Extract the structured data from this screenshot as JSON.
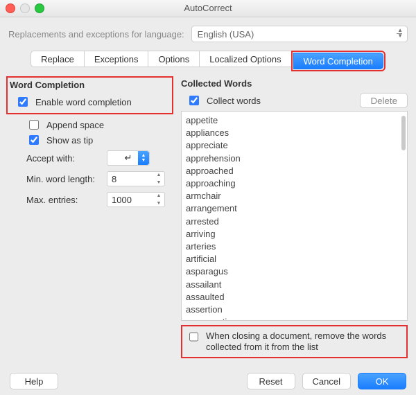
{
  "title": "AutoCorrect",
  "language_label": "Replacements and exceptions for language:",
  "language_value": "English (USA)",
  "tabs": [
    {
      "label": "Replace"
    },
    {
      "label": "Exceptions"
    },
    {
      "label": "Options"
    },
    {
      "label": "Localized Options"
    },
    {
      "label": "Word Completion",
      "active": true
    }
  ],
  "left": {
    "header": "Word Completion",
    "enable": "Enable word completion",
    "append_space": "Append space",
    "show_as_tip": "Show as tip",
    "accept_with_label": "Accept with:",
    "accept_with_value": "↵",
    "min_len_label": "Min. word length:",
    "min_len_value": "8",
    "max_entries_label": "Max. entries:",
    "max_entries_value": "1000"
  },
  "right": {
    "header": "Collected Words",
    "collect": "Collect words",
    "delete": "Delete",
    "words": [
      "appetite",
      "appliances",
      "appreciate",
      "apprehension",
      "approached",
      "approaching",
      "armchair",
      "arrangement",
      "arrested",
      "arriving",
      "arteries",
      "artificial",
      "asparagus",
      "assailant",
      "assaulted",
      "assertion",
      "asseverations"
    ],
    "remove_on_close": "When closing a document, remove the words collected from it from the list"
  },
  "footer": {
    "help": "Help",
    "reset": "Reset",
    "cancel": "Cancel",
    "ok": "OK"
  }
}
